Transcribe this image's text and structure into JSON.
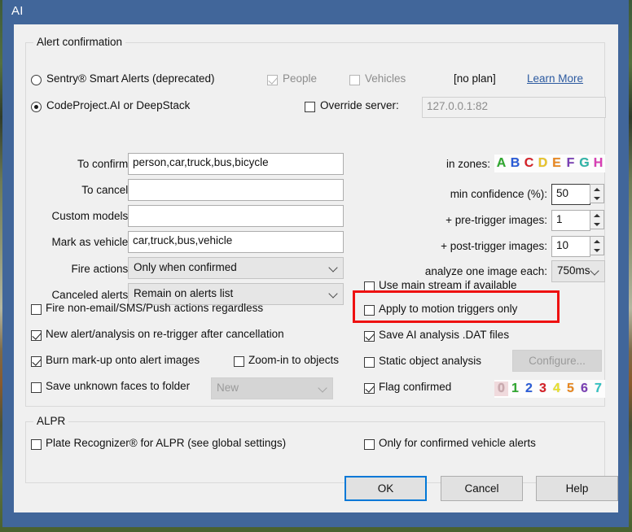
{
  "window": {
    "title": "AI"
  },
  "groups": {
    "alert_confirmation": {
      "legend": "Alert confirmation"
    },
    "alpr": {
      "legend": "ALPR"
    }
  },
  "engine": {
    "sentry_label": "Sentry® Smart Alerts (deprecated)",
    "sentry_selected": false,
    "people_label": "People",
    "people_checked": true,
    "people_disabled": true,
    "vehicles_label": "Vehicles",
    "vehicles_checked": false,
    "vehicles_disabled": true,
    "plan_label": "[no plan]",
    "learn_more_label": "Learn More",
    "codeproject_label": "CodeProject.AI or DeepStack",
    "codeproject_selected": true,
    "override_server_label": "Override server:",
    "override_server_checked": false,
    "override_server_value": "127.0.0.1:82"
  },
  "left_fields": [
    {
      "label": "To confirm:",
      "value": "person,car,truck,bus,bicycle",
      "placeholder": ""
    },
    {
      "label": "To cancel:",
      "value": "",
      "placeholder": ""
    },
    {
      "label": "Custom models:",
      "value": "",
      "placeholder": ""
    },
    {
      "label": "Mark as vehicle:",
      "value": "car,truck,bus,vehicle",
      "placeholder": ""
    }
  ],
  "left_combos": [
    {
      "label": "Fire actions:",
      "value": "Only when confirmed"
    },
    {
      "label": "Canceled alerts:",
      "value": "Remain on alerts list"
    }
  ],
  "zones": {
    "label": "in zones:",
    "letters": [
      {
        "text": "A",
        "color": "#2fa82f",
        "enabled": true
      },
      {
        "text": "B",
        "color": "#2a5cd8",
        "enabled": true
      },
      {
        "text": "C",
        "color": "#d61f26",
        "enabled": true
      },
      {
        "text": "D",
        "color": "#e8c32a",
        "enabled": true
      },
      {
        "text": "E",
        "color": "#e8871f",
        "enabled": true
      },
      {
        "text": "F",
        "color": "#7a3fb5",
        "enabled": true
      },
      {
        "text": "G",
        "color": "#2fb5a8",
        "enabled": true
      },
      {
        "text": "H",
        "color": "#d83fb5",
        "enabled": true
      }
    ]
  },
  "right_spinners": [
    {
      "label": "min confidence (%):",
      "value": "50",
      "focused": true
    },
    {
      "label": "+ pre-trigger images:",
      "value": "1",
      "focused": false
    },
    {
      "label": "+ post-trigger images:",
      "value": "10",
      "focused": false
    }
  ],
  "analyze": {
    "label": "analyze one image each:",
    "value": "750ms"
  },
  "left_checks": [
    {
      "label": "Fire non-email/SMS/Push actions regardless",
      "checked": false
    },
    {
      "label": "New alert/analysis on re-trigger after cancellation",
      "checked": true
    },
    {
      "label": "Burn mark-up onto alert images",
      "checked": true
    },
    {
      "label": "Save unknown faces to folder",
      "checked": false
    }
  ],
  "zoom_in": {
    "label": "Zoom-in to objects",
    "checked": false
  },
  "faces_folder": {
    "value": "New",
    "disabled": true
  },
  "right_checks": [
    {
      "label": "Use main stream if available",
      "checked": false
    },
    {
      "label": "Apply to motion triggers only",
      "checked": false,
      "highlighted": true
    },
    {
      "label": "Save AI analysis .DAT files",
      "checked": true
    },
    {
      "label": "Static object analysis",
      "checked": false
    },
    {
      "label": "Flag confirmed",
      "checked": true
    }
  ],
  "configure_button": {
    "label": "Configure...",
    "disabled": true
  },
  "flag_digits": [
    {
      "text": "0",
      "color": "#b3b3b3",
      "enabled": false
    },
    {
      "text": "1",
      "color": "#2fa82f",
      "enabled": true
    },
    {
      "text": "2",
      "color": "#2a5cd8",
      "enabled": true
    },
    {
      "text": "3",
      "color": "#d61f26",
      "enabled": true
    },
    {
      "text": "4",
      "color": "#e8e02a",
      "enabled": true
    },
    {
      "text": "5",
      "color": "#e8871f",
      "enabled": true
    },
    {
      "text": "6",
      "color": "#7a3fb5",
      "enabled": true
    },
    {
      "text": "7",
      "color": "#2fc2c2",
      "enabled": true
    }
  ],
  "alpr": {
    "plate_recognizer_label": "Plate Recognizer® for ALPR (see global settings)",
    "plate_recognizer_checked": false,
    "only_confirmed_label": "Only for confirmed vehicle alerts",
    "only_confirmed_checked": false
  },
  "buttons": {
    "ok": "OK",
    "cancel": "Cancel",
    "help": "Help"
  },
  "colors": {
    "titlebar": "#41669a",
    "accent": "#0078d7",
    "highlight": "#ee1111",
    "link": "#2c5aa0"
  }
}
